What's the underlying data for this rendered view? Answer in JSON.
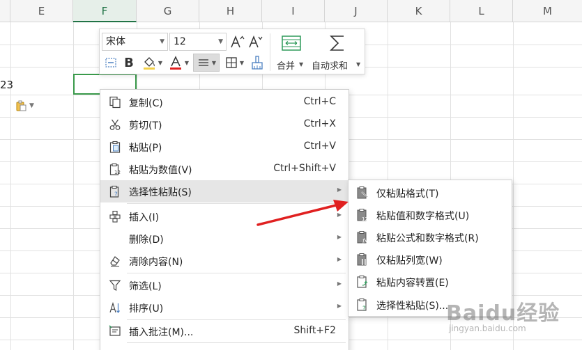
{
  "grid": {
    "columns": [
      "E",
      "F",
      "G",
      "H",
      "I",
      "J",
      "K",
      "L",
      "M"
    ],
    "active_column": "F",
    "partial_cell_text": "23"
  },
  "toolbar": {
    "font_name": "宋体",
    "font_size": "12",
    "merge_label": "合并",
    "autosum_label": "自动求和"
  },
  "context_menu": {
    "items": [
      {
        "label": "复制(C)",
        "shortcut": "Ctrl+C",
        "icon": "copy-icon"
      },
      {
        "label": "剪切(T)",
        "shortcut": "Ctrl+X",
        "icon": "scissors-icon"
      },
      {
        "label": "粘贴(P)",
        "shortcut": "Ctrl+V",
        "icon": "clipboard-icon"
      },
      {
        "label": "粘贴为数值(V)",
        "shortcut": "Ctrl+Shift+V",
        "icon": "paste-values-icon"
      },
      {
        "label": "选择性粘贴(S)",
        "shortcut": "",
        "icon": "paste-special-icon",
        "submenu": true
      },
      {
        "label": "插入(I)",
        "shortcut": "",
        "icon": "insert-cells-icon",
        "submenu": true
      },
      {
        "label": "删除(D)",
        "shortcut": "",
        "icon": "",
        "submenu": true
      },
      {
        "label": "清除内容(N)",
        "shortcut": "",
        "icon": "eraser-icon",
        "submenu": true
      },
      {
        "label": "筛选(L)",
        "shortcut": "",
        "icon": "filter-icon",
        "submenu": true
      },
      {
        "label": "排序(U)",
        "shortcut": "",
        "icon": "sort-icon",
        "submenu": true
      },
      {
        "label": "插入批注(M)...",
        "shortcut": "Shift+F2",
        "icon": "comment-icon"
      }
    ]
  },
  "submenu": {
    "items": [
      {
        "label": "仅粘贴格式(T)",
        "icon": "paste-format-icon"
      },
      {
        "label": "粘贴值和数字格式(U)",
        "icon": "paste-values-numformat-icon"
      },
      {
        "label": "粘贴公式和数字格式(R)",
        "icon": "paste-formula-numformat-icon"
      },
      {
        "label": "仅粘贴列宽(W)",
        "icon": "paste-column-width-icon"
      },
      {
        "label": "粘贴内容转置(E)",
        "icon": "paste-transpose-icon"
      },
      {
        "label": "选择性粘贴(S)...",
        "icon": "paste-special-dialog-icon"
      }
    ]
  },
  "colors": {
    "accent_green": "#217346",
    "selection_border": "#3a9a4b",
    "arrow_red": "#e02020",
    "font_color_red": "#e02020"
  },
  "watermark": {
    "logo": "Baidu经验",
    "url": "jingyan.baidu.com"
  }
}
